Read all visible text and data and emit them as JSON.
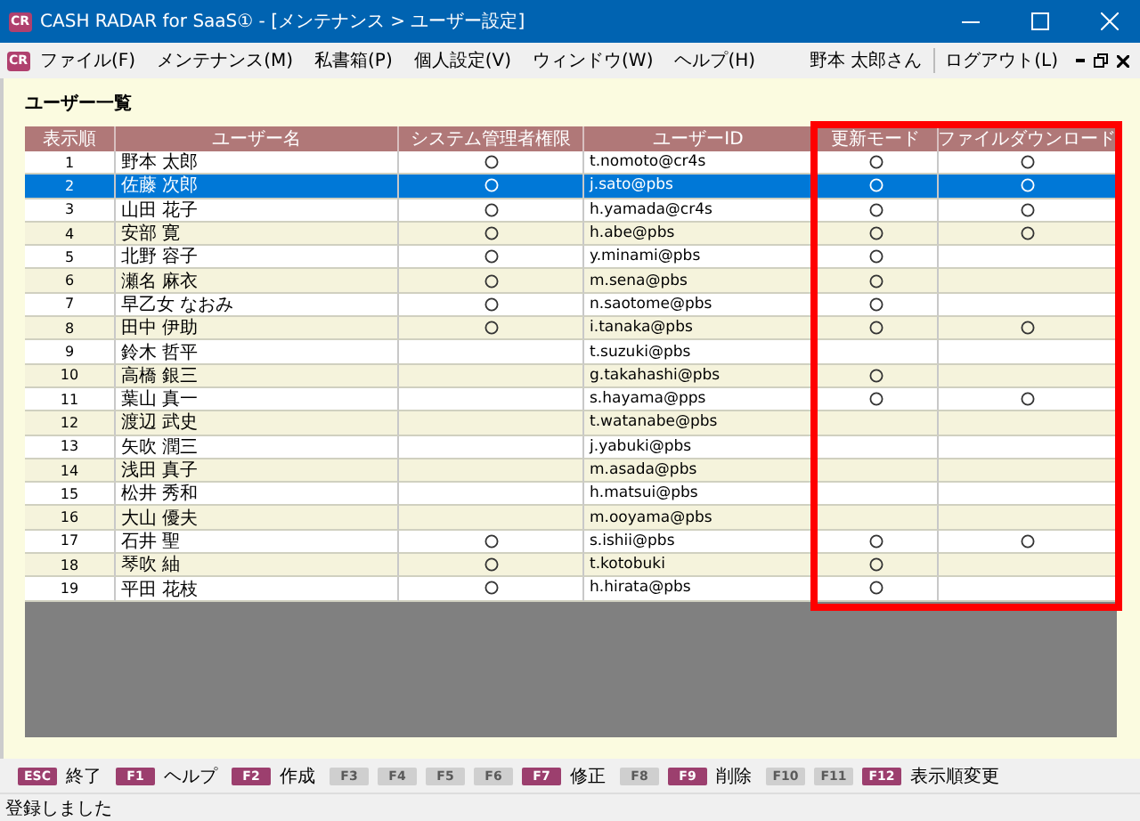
{
  "window": {
    "logo": "CR",
    "title": "CASH RADAR for SaaS① - [メンテナンス > ユーザー設定]"
  },
  "menu_bar": {
    "logo": "CR",
    "items": [
      "ファイル(F)",
      "メンテナンス(M)",
      "私書箱(P)",
      "個人設定(V)",
      "ウィンドウ(W)",
      "ヘルプ(H)"
    ],
    "user": "野本 太郎さん",
    "logout": "ログアウト(L)"
  },
  "heading": "ユーザー一覧",
  "table": {
    "columns": [
      "表示順",
      "ユーザー名",
      "システム管理者権限",
      "ユーザーID",
      "更新モード",
      "ファイルダウンロード"
    ],
    "rows": [
      {
        "order": "1",
        "name": "野本 太郎",
        "admin": true,
        "user_id": "t.nomoto@cr4s",
        "update": true,
        "download": true,
        "selected": false
      },
      {
        "order": "2",
        "name": "佐藤 次郎",
        "admin": true,
        "user_id": "j.sato@pbs",
        "update": true,
        "download": true,
        "selected": true
      },
      {
        "order": "3",
        "name": "山田 花子",
        "admin": true,
        "user_id": "h.yamada@cr4s",
        "update": true,
        "download": true,
        "selected": false
      },
      {
        "order": "4",
        "name": "安部 寛",
        "admin": true,
        "user_id": "h.abe@pbs",
        "update": true,
        "download": true,
        "selected": false
      },
      {
        "order": "5",
        "name": "北野 容子",
        "admin": true,
        "user_id": "y.minami@pbs",
        "update": true,
        "download": false,
        "selected": false
      },
      {
        "order": "6",
        "name": "瀬名 麻衣",
        "admin": true,
        "user_id": "m.sena@pbs",
        "update": true,
        "download": false,
        "selected": false
      },
      {
        "order": "7",
        "name": "早乙女 なおみ",
        "admin": true,
        "user_id": "n.saotome@pbs",
        "update": true,
        "download": false,
        "selected": false
      },
      {
        "order": "8",
        "name": "田中 伊助",
        "admin": true,
        "user_id": "i.tanaka@pbs",
        "update": true,
        "download": true,
        "selected": false
      },
      {
        "order": "9",
        "name": "鈴木 哲平",
        "admin": false,
        "user_id": "t.suzuki@pbs",
        "update": false,
        "download": false,
        "selected": false
      },
      {
        "order": "10",
        "name": "高橋 銀三",
        "admin": false,
        "user_id": "g.takahashi@pbs",
        "update": true,
        "download": false,
        "selected": false
      },
      {
        "order": "11",
        "name": "葉山 真一",
        "admin": false,
        "user_id": "s.hayama@pps",
        "update": true,
        "download": true,
        "selected": false
      },
      {
        "order": "12",
        "name": "渡辺 武史",
        "admin": false,
        "user_id": "t.watanabe@pbs",
        "update": false,
        "download": false,
        "selected": false
      },
      {
        "order": "13",
        "name": "矢吹 潤三",
        "admin": false,
        "user_id": "j.yabuki@pbs",
        "update": false,
        "download": false,
        "selected": false
      },
      {
        "order": "14",
        "name": "浅田 真子",
        "admin": false,
        "user_id": "m.asada@pbs",
        "update": false,
        "download": false,
        "selected": false
      },
      {
        "order": "15",
        "name": "松井 秀和",
        "admin": false,
        "user_id": "h.matsui@pbs",
        "update": false,
        "download": false,
        "selected": false
      },
      {
        "order": "16",
        "name": "大山 優夫",
        "admin": false,
        "user_id": "m.ooyama@pbs",
        "update": false,
        "download": false,
        "selected": false
      },
      {
        "order": "17",
        "name": "石井 聖",
        "admin": true,
        "user_id": "s.ishii@pbs",
        "update": true,
        "download": true,
        "selected": false
      },
      {
        "order": "18",
        "name": "琴吹 紬",
        "admin": true,
        "user_id": "t.kotobuki",
        "update": true,
        "download": false,
        "selected": false
      },
      {
        "order": "19",
        "name": "平田 花枝",
        "admin": true,
        "user_id": "h.hirata@pbs",
        "update": true,
        "download": false,
        "selected": false
      }
    ]
  },
  "function_keys": [
    {
      "key": "ESC",
      "label": "終了",
      "disabled": false
    },
    {
      "key": "F1",
      "label": "ヘルプ",
      "disabled": false
    },
    {
      "key": "F2",
      "label": "作成",
      "disabled": false
    },
    {
      "key": "F3",
      "disabled": true
    },
    {
      "key": "F4",
      "disabled": true
    },
    {
      "key": "F5",
      "disabled": true
    },
    {
      "key": "F6",
      "disabled": true
    },
    {
      "key": "F7",
      "label": "修正",
      "disabled": false
    },
    {
      "key": "F8",
      "disabled": true
    },
    {
      "key": "F9",
      "label": "削除",
      "disabled": false
    },
    {
      "key": "F10",
      "disabled": true
    },
    {
      "key": "F11",
      "disabled": true
    },
    {
      "key": "F12",
      "label": "表示順変更",
      "disabled": false
    }
  ],
  "status_bar": "登録しました"
}
